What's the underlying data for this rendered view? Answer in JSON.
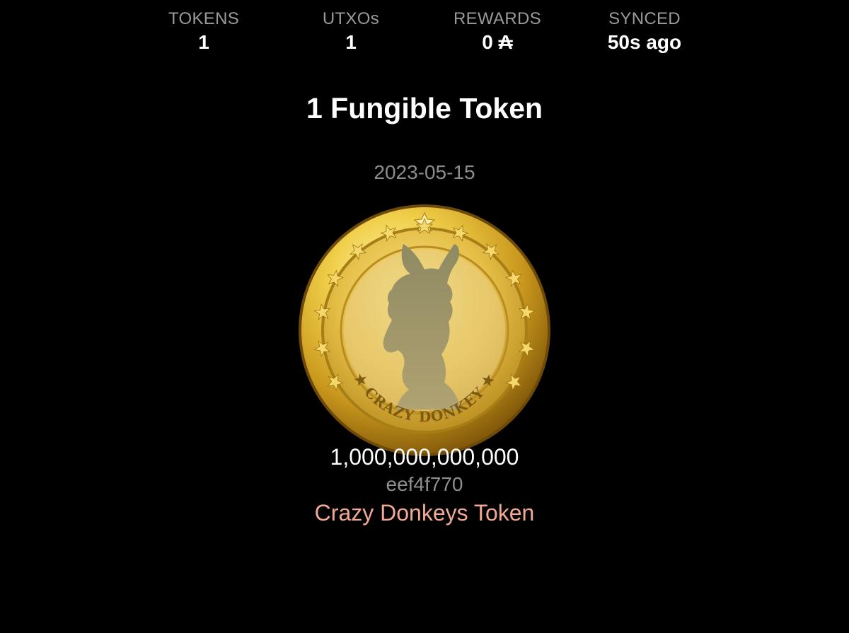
{
  "stats": {
    "tokens": {
      "label": "TOKENS",
      "value": "1"
    },
    "utxos": {
      "label": "UTXOs",
      "value": "1"
    },
    "rewards": {
      "label": "REWARDS",
      "value": "0 ₳"
    },
    "synced": {
      "label": "SYNCED",
      "value": "50s ago"
    }
  },
  "page_title": "1 Fungible Token",
  "token": {
    "date": "2023-05-15",
    "amount": "1,000,000,000,000",
    "policy_id": "eef4f770",
    "name": "Crazy Donkeys Token",
    "image_icon": "crazy-donkey-coin-icon",
    "name_color": "#f0a995"
  },
  "colors": {
    "background": "#000000",
    "label_gray": "#9a9a9a",
    "gold": "#e7c54a"
  }
}
